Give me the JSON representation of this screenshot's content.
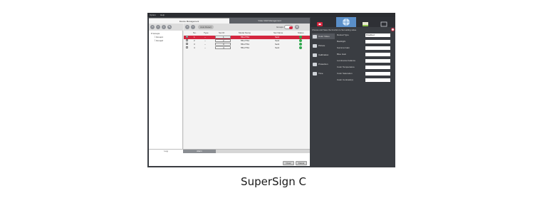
{
  "menubar": {
    "items": [
      "Option",
      "Help"
    ]
  },
  "tabs": {
    "device_management": "Device Management",
    "video_wall": "Video Wall Management"
  },
  "tree": {
    "root": "Groups",
    "children": [
      "Group1",
      "Group2"
    ]
  },
  "toolbar": {
    "pill_label": "Auto Detect",
    "groups_label": "Groups"
  },
  "table": {
    "headers": [
      "",
      "No.",
      "Type",
      "Set ID",
      "Model Name",
      "Set Name",
      "Status"
    ],
    "rows": [
      {
        "no": "1",
        "type": "--",
        "set_id": "1",
        "model": "55LV75A",
        "set_name": "Set1",
        "selected": true
      },
      {
        "no": "2",
        "type": "--",
        "set_id": "2",
        "model": "55LV75A",
        "set_name": "Set2",
        "selected": false
      },
      {
        "no": "3",
        "type": "--",
        "set_id": "3",
        "model": "55LV75A",
        "set_name": "Set3",
        "selected": false
      },
      {
        "no": "4",
        "type": "--",
        "set_id": "4",
        "model": "55LV75A",
        "set_name": "Set4",
        "selected": false
      }
    ]
  },
  "log": {
    "tabs": [
      "Log",
      "Alarm"
    ],
    "buttons": {
      "clear": "Clear",
      "delete": "Delete"
    }
  },
  "topicons": [
    "power-icon",
    "globe-icon",
    "folder-icon",
    "screen-icon"
  ],
  "nav": {
    "items": [
      "Color Video",
      "Picture",
      "Calibration",
      "Protection",
      "Time"
    ]
  },
  "settings": {
    "description": "Choose and Save the function to Set setting value.",
    "rows": [
      {
        "label": "Reload Type",
        "value": "Disabled"
      },
      {
        "label": "Backlight",
        "value": ""
      },
      {
        "label": "Gamma Gain",
        "value": ""
      },
      {
        "label": "Blue Gain",
        "value": ""
      },
      {
        "label": "Luminance balance",
        "value": ""
      },
      {
        "label": "Color Temperature",
        "value": ""
      },
      {
        "label": "Color Saturation",
        "value": ""
      },
      {
        "label": "Color Contrast(s)",
        "value": ""
      }
    ]
  },
  "caption": "SuperSign C",
  "colors": {
    "accent_red": "#d4263f",
    "dark_panel": "#3a3d42",
    "status_green": "#2fa84f"
  }
}
